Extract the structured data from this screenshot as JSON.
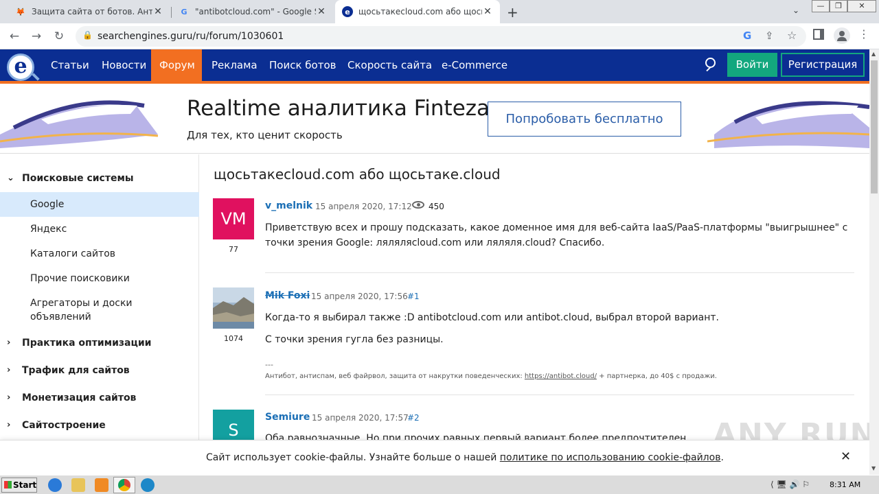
{
  "browser": {
    "tabs": [
      {
        "title": "Защита сайта от ботов. Антибот,"
      },
      {
        "title": "\"antibotcloud.com\" - Google Suche"
      },
      {
        "title": "щосьтакеcloud.com або щосьтаке"
      }
    ],
    "new_tab": "+",
    "url": "searchengines.guru/ru/forum/1030601"
  },
  "site_nav": {
    "logo": "e",
    "items": [
      "Статьи",
      "Новости",
      "Форум",
      "Реклама",
      "Поиск ботов",
      "Скорость сайта",
      "e-Commerce"
    ],
    "active_item": "Форум",
    "login": "Войти",
    "register": "Регистрация"
  },
  "banner": {
    "title": "Realtime аналитика Finteza",
    "subtitle": "Для тех, кто ценит скорость",
    "button": "Попробовать бесплатно"
  },
  "sidebar": {
    "category_open": "Поисковые системы",
    "items": [
      "Google",
      "Яндекс",
      "Каталоги сайтов",
      "Прочие поисковики",
      "Агрегаторы и доски объявлений"
    ],
    "active_item": "Google",
    "categories": [
      "Практика оптимизации",
      "Трафик для сайтов",
      "Монетизация сайтов",
      "Сайтостроение"
    ]
  },
  "topic": {
    "title": "щосьтакеcloud.com або щосьтаке.cloud",
    "posts": [
      {
        "avatar_text": "VM",
        "avatar_color": "#e0115f",
        "count": "77",
        "author": "v_melnik",
        "date": "15 апреля 2020, 17:12",
        "views": "450",
        "text": "Приветствую всех и прошу подсказать, какое доменное имя для веб-сайта IaaS/PaaS-платформы \"выигрышнее\" с точки зрения Google: ляляляcloud.com или ляляля.cloud? Спасибо."
      },
      {
        "avatar_text": "",
        "count": "1074",
        "author": "Mik Foxi",
        "date": "15 апреля 2020, 17:56",
        "number": "#1",
        "text1": "Когда-то я выбирал также :D antibotcloud.com или antibot.cloud, выбрал второй вариант.",
        "text2": "С точки зрения гугла без разницы.",
        "sig_sep": "---",
        "sig_text": "Антибот, антиспам, веб файрвол, защита от накрутки поведенческих:",
        "sig_link": "https://antibot.cloud/",
        "sig_tail": "+ партнерка, до 40$ с продажи."
      },
      {
        "avatar_text": "S",
        "avatar_color": "#13a0a0",
        "author": "Semiure",
        "date": "15 апреля 2020, 17:57",
        "number": "#2",
        "text": "Оба равнозначные. Но при прочих равных первый вариант более предпочтителен."
      }
    ]
  },
  "cookie": {
    "text": "Сайт использует cookie-файлы. Узнайте больше о нашей",
    "link": "политике по использованию cookie-файлов",
    "end": "."
  },
  "taskbar": {
    "start": "Start",
    "clock": "8:31 AM"
  },
  "watermark": "ANY RUN"
}
